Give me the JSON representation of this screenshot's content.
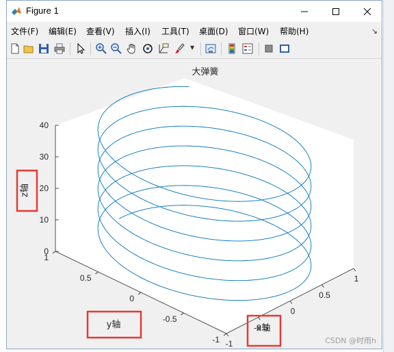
{
  "window": {
    "title": "Figure 1"
  },
  "menu": {
    "items": [
      "文件(F)",
      "编辑(E)",
      "查看(V)",
      "插入(I)",
      "工具(T)",
      "桌面(D)",
      "窗口(W)",
      "帮助(H)"
    ],
    "overflow_icon": "dock-arrow-icon"
  },
  "toolbar": {
    "icons": [
      "new-figure-icon",
      "open-file-icon",
      "save-icon",
      "print-icon",
      "edit-plot-icon",
      "zoom-in-icon",
      "zoom-out-icon",
      "pan-icon",
      "rotate-3d-icon",
      "data-cursor-icon",
      "brush-icon",
      "brush-dropdown-icon",
      "link-plot-icon",
      "colorbar-icon",
      "legend-icon",
      "hide-plot-tools-icon",
      "show-plot-tools-icon"
    ]
  },
  "chart_data": {
    "type": "line",
    "title": "大弹簧",
    "xlabel": "x轴",
    "ylabel": "y轴",
    "zlabel": "z轴",
    "xlim": [
      -1,
      1
    ],
    "ylim": [
      -1,
      1
    ],
    "zlim": [
      0,
      40
    ],
    "xticks": [
      "-1",
      "-0.5",
      "0",
      "0.5",
      "1"
    ],
    "yticks": [
      "-1",
      "-0.5",
      "0",
      "0.5",
      "1"
    ],
    "zticks": [
      "0",
      "10",
      "20",
      "30",
      "40"
    ],
    "series": [
      {
        "equation": "x = sin(t), y = cos(t), z = t",
        "t_range": [
          0,
          12.25
        ],
        "t_range_in_pi": true,
        "color": "#0072bd"
      }
    ],
    "highlight_color": "#e53935"
  },
  "watermark": "CSDN @时雨h"
}
